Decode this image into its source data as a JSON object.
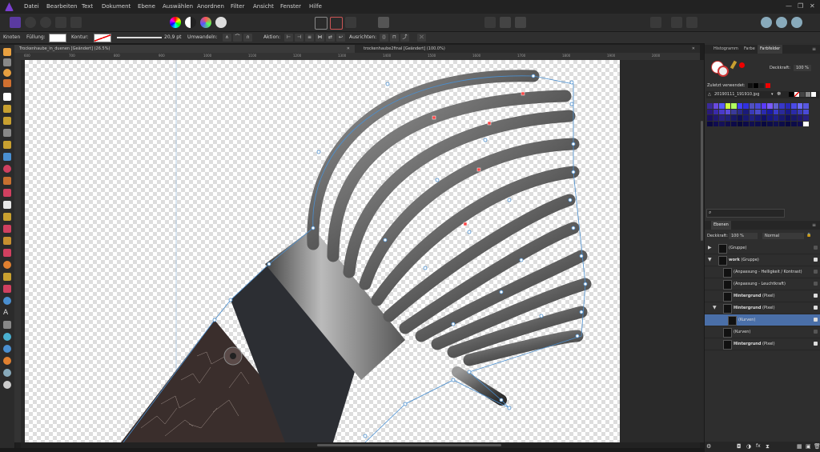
{
  "menu": [
    "Datei",
    "Bearbeiten",
    "Text",
    "Dokument",
    "Ebene",
    "Auswählen",
    "Anordnen",
    "Filter",
    "Ansicht",
    "Fenster",
    "Hilfe"
  ],
  "context": {
    "mode": "Knoten",
    "fill_label": "Füllung:",
    "stroke_label": "Kontur:",
    "stroke_width": "20,9 pt",
    "convert_label": "Umwandeln:",
    "action_label": "Aktion:",
    "align_label": "Ausrichten:"
  },
  "tabs": [
    {
      "label": "Trockenhaube_in_duenen [Geändert] (26.5%)",
      "active": true
    },
    {
      "label": "trockenhaube2final [Geändert] (100.0%)",
      "active": false
    }
  ],
  "ruler_ticks": [
    "600",
    "700",
    "800",
    "900",
    "1000",
    "1100",
    "1200",
    "1300",
    "1400",
    "1500",
    "1600",
    "1700",
    "1800",
    "1900",
    "2000"
  ],
  "panel": {
    "top_tabs": [
      "Histogramm",
      "Farbe",
      "Farbfelder"
    ],
    "active_top_tab": "Farbfelder",
    "opacity_label": "Deckkraft:",
    "opacity_value": "100 %",
    "recent_label": "Zuletzt verwendet:",
    "palette_name": "20190111_191910.jpg",
    "search_placeholder": "",
    "layers_tab": "Ebenen",
    "layers_opacity_label": "Deckkraft:",
    "layers_opacity_value": "100 %",
    "blend_mode": "Normal",
    "layers": [
      {
        "name": "(Gruppe)",
        "bold": "",
        "indent": 0,
        "expand": "▶",
        "sel": false,
        "vis": false
      },
      {
        "name": "(Gruppe)",
        "bold": "work",
        "indent": 0,
        "expand": "▼",
        "sel": false,
        "vis": true
      },
      {
        "name": "(Anpassung - Helligkeit / Kontrast)",
        "bold": "",
        "indent": 1,
        "expand": "",
        "sel": false,
        "vis": false
      },
      {
        "name": "(Anpassung - Leuchtkraft)",
        "bold": "",
        "indent": 1,
        "expand": "",
        "sel": false,
        "vis": false
      },
      {
        "name": "(Pixel)",
        "bold": "Hintergrund",
        "indent": 1,
        "expand": "",
        "sel": false,
        "vis": true
      },
      {
        "name": "(Pixel)",
        "bold": "Hintergrund",
        "indent": 1,
        "expand": "▼",
        "sel": false,
        "vis": true
      },
      {
        "name": "(Kurven)",
        "bold": "",
        "indent": 2,
        "expand": "",
        "sel": true,
        "vis": true
      },
      {
        "name": "(Kurven)",
        "bold": "",
        "indent": 1,
        "expand": "",
        "sel": false,
        "vis": false
      },
      {
        "name": "(Pixel)",
        "bold": "Hintergrund",
        "indent": 1,
        "expand": "",
        "sel": false,
        "vis": true
      }
    ]
  },
  "colors": {
    "accent": "#4a6fa8",
    "brand": "#7a3fd0",
    "selection_node": "#4a8fd0"
  }
}
